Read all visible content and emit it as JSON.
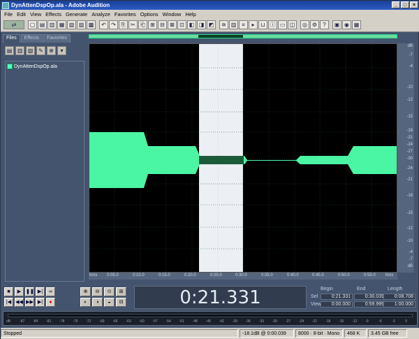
{
  "window": {
    "title": "DynAttenDspOp.ala - Adobe Audition"
  },
  "menu": [
    "File",
    "Edit",
    "View",
    "Effects",
    "Generate",
    "Analyze",
    "Favorites",
    "Options",
    "Window",
    "Help"
  ],
  "left_panel": {
    "tabs": [
      "Files",
      "Effects",
      "Favorites"
    ],
    "files": [
      "DynAttenDspOp.ala"
    ]
  },
  "db_scale": {
    "upper": [
      "dB",
      "-7",
      "-4",
      "-10",
      "-12",
      "-15",
      "-18",
      "-21",
      "-24",
      "-27",
      "-30"
    ],
    "lower": [
      "-24",
      "-21",
      "-18",
      "-15",
      "-12",
      "-10",
      "-4",
      "-7",
      "dB"
    ]
  },
  "time_ruler": {
    "unit": "hms",
    "ticks": [
      "0:05.0",
      "0:10.0",
      "0:15.0",
      "0:20.0",
      "0:25.0",
      "0:30.0",
      "0:35.0",
      "0:40.0",
      "0:45.0",
      "0:50.0",
      "0:55.0"
    ]
  },
  "time_display": "0:21.331",
  "selection_info": {
    "headers": [
      "Begin",
      "End",
      "Length"
    ],
    "sel_label": "Sel",
    "view_label": "View",
    "sel": [
      "0:21.331",
      "0:30.039",
      "0:08.708"
    ],
    "view": [
      "0:00.000",
      "0:59.999",
      "1:00.000"
    ]
  },
  "level_meter": {
    "ticks": [
      "dB",
      "-87",
      "-84",
      "-81",
      "-78",
      "-75",
      "-72",
      "-69",
      "-66",
      "-63",
      "-60",
      "-57",
      "-54",
      "-51",
      "-48",
      "-45",
      "-42",
      "-39",
      "-36",
      "-33",
      "-30",
      "-27",
      "-24",
      "-21",
      "-18",
      "-15",
      "-12",
      "-9",
      "-6",
      "-3",
      "0"
    ]
  },
  "status": {
    "state": "Stopped",
    "level": "-18.1dB @ 0:00.039",
    "format": "8000 · 8-bit · Mono",
    "size": "468 K",
    "free": "3.45 GB free"
  },
  "colors": {
    "waveform": "#4af5a4",
    "selection": "#eceff4",
    "background": "#44546e"
  }
}
